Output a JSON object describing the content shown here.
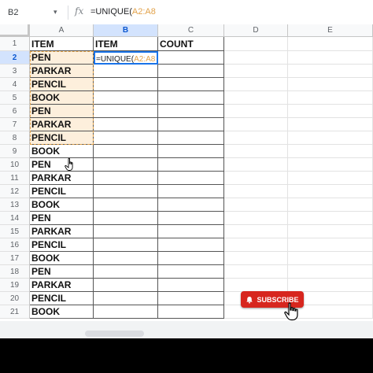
{
  "formula_bar": {
    "name_box": "B2",
    "name_box_caret": "▾",
    "fx_label": "fx",
    "formula_prefix": "=UNIQUE(",
    "formula_range": "A2:A8"
  },
  "columns": [
    "A",
    "B",
    "C",
    "D",
    "E"
  ],
  "rows": [
    "1",
    "2",
    "3",
    "4",
    "5",
    "6",
    "7",
    "8",
    "9",
    "10",
    "11",
    "12",
    "13",
    "14",
    "15",
    "16",
    "17",
    "18",
    "19",
    "20",
    "21"
  ],
  "column_a": [
    "ITEM",
    "PEN",
    "PARKAR",
    "PENCIL",
    "BOOK",
    "PEN",
    "PARKAR",
    "PENCIL",
    "BOOK",
    "PEN",
    "PARKAR",
    "PENCIL",
    "BOOK",
    "PEN",
    "PARKAR",
    "PENCIL",
    "BOOK",
    "PEN",
    "PARKAR",
    "PENCIL",
    "BOOK"
  ],
  "b1": "ITEM",
  "c1": "COUNT",
  "active_cell": {
    "prefix": "=UNIQUE(",
    "range": "A2:A8"
  },
  "subscribe": {
    "label": "SUBSCRIBE"
  },
  "colors": {
    "accent": "#1a73e8",
    "range_highlight": "#e2a24a",
    "subscribe_red": "#d7261e"
  }
}
